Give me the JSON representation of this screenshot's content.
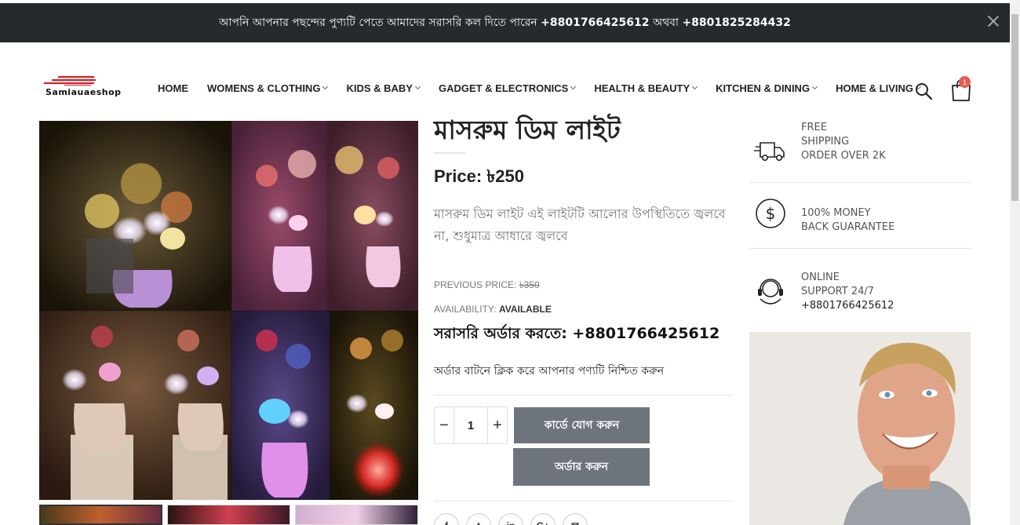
{
  "announcement": {
    "text_prefix": "আপনি আপনার পছন্দের পুণ্যটি পেতে আমাদের সরাসরি কল দিতে পারেন ",
    "phone1": "+8801766425612",
    "middle": " অথবা ",
    "phone2": "+8801825284432"
  },
  "logo": {
    "text": "Samiauaeshop"
  },
  "nav": [
    {
      "label": "HOME",
      "has_dropdown": false
    },
    {
      "label": "WOMENS & CLOTHING",
      "has_dropdown": true
    },
    {
      "label": "KIDS & BABY",
      "has_dropdown": true
    },
    {
      "label": "GADGET & ELECTRONICS",
      "has_dropdown": true
    },
    {
      "label": "HEALTH & BEAUTY",
      "has_dropdown": true
    },
    {
      "label": "KITCHEN & DINING",
      "has_dropdown": true
    },
    {
      "label": "HOME & LIVING",
      "has_dropdown": true
    }
  ],
  "cart": {
    "count": "1"
  },
  "product": {
    "title": "মাসরুম ডিম লাইট",
    "price_label": "Price: ",
    "price_value": "৳250",
    "description": "মাসরুম ডিম লাইট এই লাইটটি আলোর উপস্থিতিতে জ্বলবে না, শুধুমাত্র আধারে জ্বলবে",
    "previous_price_label": "PREVIOUS PRICE: ",
    "previous_price_value": "৳350",
    "availability_label": "AVAILABILITY: ",
    "availability_value": "AVAILABLE",
    "direct_order": "সরাসরি অর্ডার করতে: +8801766425612",
    "order_note": "অর্ডার বাটনে ক্লিক করে আপনার পণ্যটি নিশ্চিত করুন",
    "quantity": "1",
    "add_to_cart_label": "কার্ডে যোগ করুন",
    "order_label": "অর্ডার করুন"
  },
  "features": [
    {
      "icon": "truck-icon",
      "lines": [
        "FREE",
        "SHIPPING",
        "ORDER OVER 2K"
      ]
    },
    {
      "icon": "dollar-coin-icon",
      "lines": [
        "100% MONEY",
        "BACK GUARANTEE"
      ]
    },
    {
      "icon": "headset-support-icon",
      "lines": [
        "ONLINE",
        "SUPPORT 24/7",
        "+8801766425612"
      ]
    }
  ],
  "colors": {
    "announce_bg": "#26292e",
    "button_bg": "#6d747c",
    "badge": "#e85a4f"
  }
}
